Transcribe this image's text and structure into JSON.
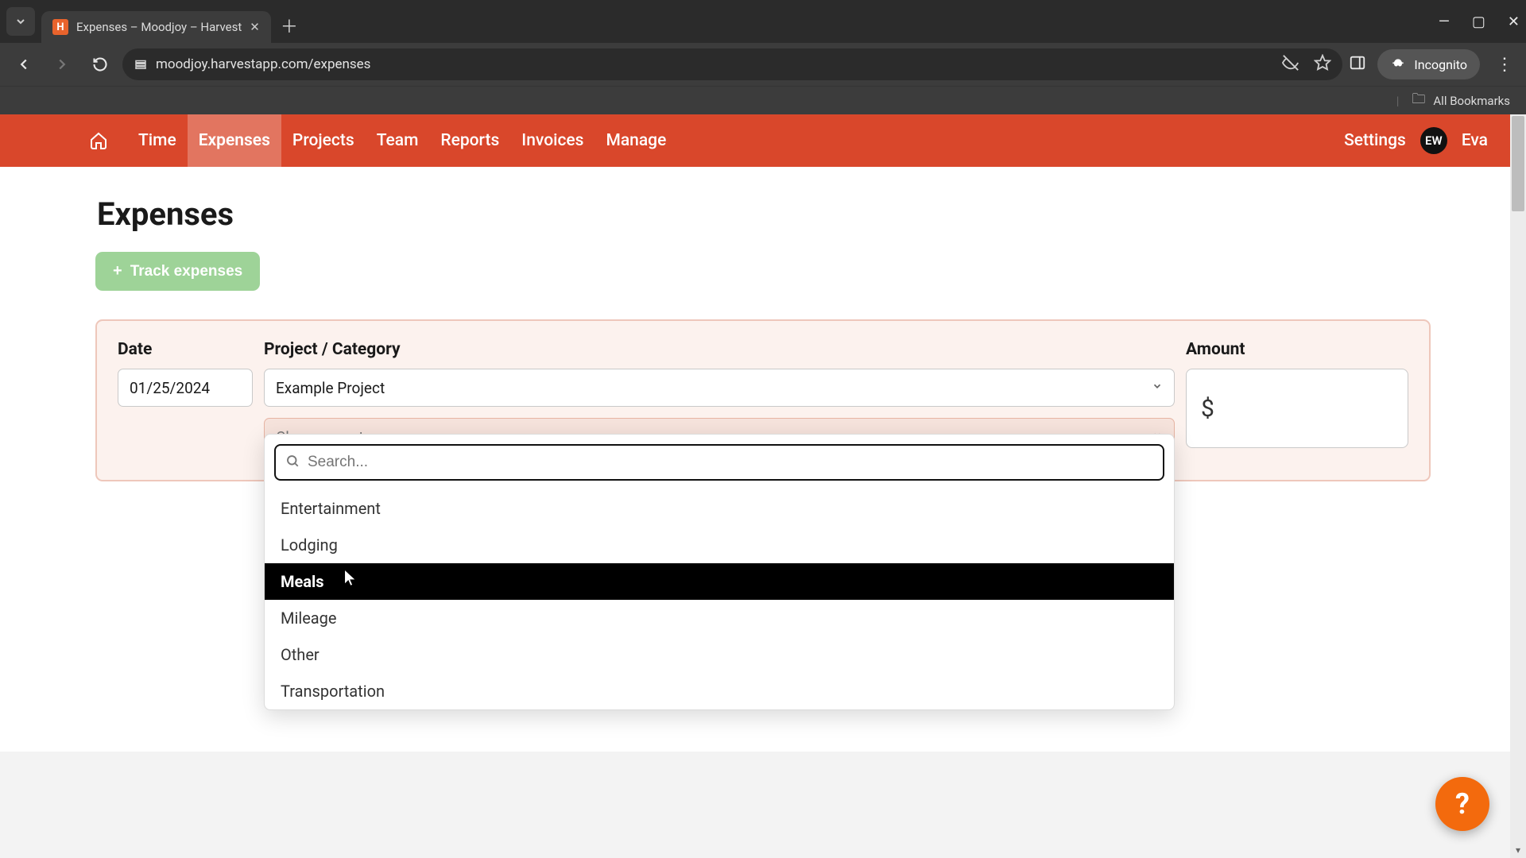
{
  "browser": {
    "tab_title": "Expenses – Moodjoy – Harvest",
    "url": "moodjoy.harvestapp.com/expenses",
    "incognito_label": "Incognito",
    "all_bookmarks_label": "All Bookmarks"
  },
  "app_nav": {
    "items": [
      {
        "label": "Time",
        "active": false
      },
      {
        "label": "Expenses",
        "active": true
      },
      {
        "label": "Projects",
        "active": false
      },
      {
        "label": "Team",
        "active": false
      },
      {
        "label": "Reports",
        "active": false
      },
      {
        "label": "Invoices",
        "active": false
      },
      {
        "label": "Manage",
        "active": false
      }
    ],
    "settings_label": "Settings",
    "user_initials": "EW",
    "user_name": "Eva"
  },
  "page": {
    "title": "Expenses",
    "track_button_label": "Track expenses"
  },
  "form": {
    "date_label": "Date",
    "date_value": "01/25/2024",
    "project_label": "Project / Category",
    "project_value": "Example Project",
    "category_placeholder": "Choose a category...",
    "amount_label": "Amount",
    "amount_currency": "$",
    "amount_value": ""
  },
  "dropdown": {
    "search_placeholder": "Search...",
    "options": [
      {
        "label": "Entertainment",
        "highlight": false
      },
      {
        "label": "Lodging",
        "highlight": false
      },
      {
        "label": "Meals",
        "highlight": true
      },
      {
        "label": "Mileage",
        "highlight": false
      },
      {
        "label": "Other",
        "highlight": false
      },
      {
        "label": "Transportation",
        "highlight": false
      }
    ]
  },
  "help_fab_label": "?",
  "colors": {
    "brand_red": "#d9472b",
    "track_green": "#9ed398",
    "help_orange": "#f36a0d",
    "card_bg": "#fcf2ee",
    "card_border": "#eec7bb"
  }
}
